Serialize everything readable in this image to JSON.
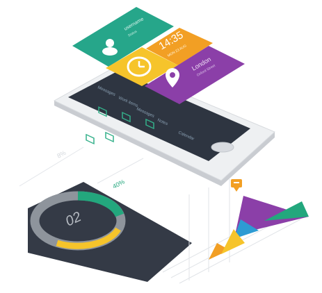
{
  "tiles": {
    "profile": {
      "name": "username",
      "sub": "Status"
    },
    "clock": {
      "time": "14:35",
      "sub": "MON 23 AUG"
    },
    "location": {
      "city": "London",
      "sub": "Oxford Street"
    }
  },
  "screen_list": [
    {
      "label": "Messages"
    },
    {
      "label": "Work items"
    },
    {
      "label": "Messages"
    },
    {
      "label": "Notes"
    },
    {
      "label": "Calendar"
    }
  ],
  "donut": {
    "value_label": "02",
    "percent_label": "40%",
    "faint_label": "8%"
  },
  "colors": {
    "teal": "#27a58a",
    "orange": "#f29f24",
    "yellow": "#f6c42b",
    "purple": "#8b3fa8",
    "blue": "#2d9bd3",
    "dark": "#343a46",
    "green": "#23a77d"
  },
  "icons": {
    "profile": "user-icon",
    "clock": "clock-icon",
    "location": "map-pin-icon",
    "list": "folder-icon",
    "pin": "chart-pin-icon"
  }
}
